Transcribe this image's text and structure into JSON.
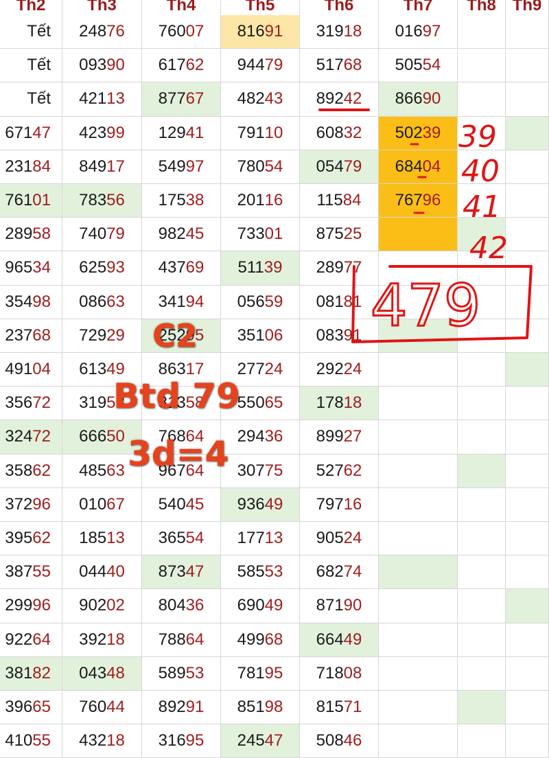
{
  "headers": [
    "Th2",
    "Th3",
    "Th4",
    "Th5",
    "Th6",
    "Th7",
    "Th8",
    "Th9"
  ],
  "rows": [
    [
      {
        "v": "Tết"
      },
      {
        "v": "24876"
      },
      {
        "v": "76007"
      },
      {
        "v": "81691",
        "bg": "yellow"
      },
      {
        "v": "31918"
      },
      {
        "v": "01697"
      },
      {
        "v": ""
      },
      {
        "v": ""
      }
    ],
    [
      {
        "v": "Tết"
      },
      {
        "v": "09390"
      },
      {
        "v": "61762"
      },
      {
        "v": "94479"
      },
      {
        "v": "51768"
      },
      {
        "v": "50554"
      },
      {
        "v": ""
      },
      {
        "v": ""
      }
    ],
    [
      {
        "v": "Tết"
      },
      {
        "v": "42113"
      },
      {
        "v": "87767",
        "bg": "green"
      },
      {
        "v": "48243"
      },
      {
        "v": "89242"
      },
      {
        "v": "86690",
        "bg": "green"
      },
      {
        "v": ""
      },
      {
        "v": ""
      }
    ],
    [
      {
        "v": "67147"
      },
      {
        "v": "42399"
      },
      {
        "v": "12941"
      },
      {
        "v": "79110"
      },
      {
        "v": "60832"
      },
      {
        "v": "50239",
        "bg": "orange"
      },
      {
        "v": ""
      },
      {
        "v": "",
        "bg": "green"
      }
    ],
    [
      {
        "v": "23184"
      },
      {
        "v": "84917"
      },
      {
        "v": "54997"
      },
      {
        "v": "78054"
      },
      {
        "v": "05479",
        "bg": "green"
      },
      {
        "v": "68404",
        "bg": "orange"
      },
      {
        "v": ""
      },
      {
        "v": ""
      }
    ],
    [
      {
        "v": "76101",
        "bg": "green"
      },
      {
        "v": "78356",
        "bg": "green"
      },
      {
        "v": "17538"
      },
      {
        "v": "20116"
      },
      {
        "v": "11584"
      },
      {
        "v": "76796",
        "bg": "orange"
      },
      {
        "v": ""
      },
      {
        "v": ""
      }
    ],
    [
      {
        "v": "28958"
      },
      {
        "v": "74079"
      },
      {
        "v": "98245"
      },
      {
        "v": "73301"
      },
      {
        "v": "87525"
      },
      {
        "v": "",
        "bg": "orange"
      },
      {
        "v": "",
        "bg": "green"
      },
      {
        "v": ""
      }
    ],
    [
      {
        "v": "96534"
      },
      {
        "v": "62593"
      },
      {
        "v": "43769"
      },
      {
        "v": "51139",
        "bg": "green"
      },
      {
        "v": "28977"
      },
      {
        "v": ""
      },
      {
        "v": ""
      },
      {
        "v": ""
      }
    ],
    [
      {
        "v": "35498"
      },
      {
        "v": "08663"
      },
      {
        "v": "34194"
      },
      {
        "v": "05659"
      },
      {
        "v": "08181"
      },
      {
        "v": ""
      },
      {
        "v": ""
      },
      {
        "v": ""
      }
    ],
    [
      {
        "v": "23768"
      },
      {
        "v": "72929"
      },
      {
        "v": "25295",
        "bg": "green"
      },
      {
        "v": "35106"
      },
      {
        "v": "08391"
      },
      {
        "v": "",
        "bg": "green"
      },
      {
        "v": ""
      },
      {
        "v": ""
      }
    ],
    [
      {
        "v": "49104"
      },
      {
        "v": "61349"
      },
      {
        "v": "86317"
      },
      {
        "v": "27724"
      },
      {
        "v": "29224"
      },
      {
        "v": ""
      },
      {
        "v": ""
      },
      {
        "v": "",
        "bg": "green"
      }
    ],
    [
      {
        "v": "35672"
      },
      {
        "v": "31953"
      },
      {
        "v": "81358"
      },
      {
        "v": "55065"
      },
      {
        "v": "17818",
        "bg": "green"
      },
      {
        "v": ""
      },
      {
        "v": ""
      },
      {
        "v": ""
      }
    ],
    [
      {
        "v": "32472",
        "bg": "green"
      },
      {
        "v": "66650",
        "bg": "green"
      },
      {
        "v": "76864"
      },
      {
        "v": "29436"
      },
      {
        "v": "89927"
      },
      {
        "v": ""
      },
      {
        "v": ""
      },
      {
        "v": ""
      }
    ],
    [
      {
        "v": "35862"
      },
      {
        "v": "48563"
      },
      {
        "v": "96764"
      },
      {
        "v": "30775"
      },
      {
        "v": "52762"
      },
      {
        "v": ""
      },
      {
        "v": "",
        "bg": "green"
      },
      {
        "v": ""
      }
    ],
    [
      {
        "v": "37296"
      },
      {
        "v": "01067"
      },
      {
        "v": "54045"
      },
      {
        "v": "93649",
        "bg": "green"
      },
      {
        "v": "79716"
      },
      {
        "v": ""
      },
      {
        "v": ""
      },
      {
        "v": ""
      }
    ],
    [
      {
        "v": "39562"
      },
      {
        "v": "18513"
      },
      {
        "v": "36554"
      },
      {
        "v": "17713"
      },
      {
        "v": "90524"
      },
      {
        "v": ""
      },
      {
        "v": ""
      },
      {
        "v": ""
      }
    ],
    [
      {
        "v": "38755"
      },
      {
        "v": "04440"
      },
      {
        "v": "87347",
        "bg": "green"
      },
      {
        "v": "58553"
      },
      {
        "v": "68274"
      },
      {
        "v": "",
        "bg": "green"
      },
      {
        "v": ""
      },
      {
        "v": ""
      }
    ],
    [
      {
        "v": "29996"
      },
      {
        "v": "90202"
      },
      {
        "v": "80436"
      },
      {
        "v": "69049"
      },
      {
        "v": "87190"
      },
      {
        "v": ""
      },
      {
        "v": ""
      },
      {
        "v": "",
        "bg": "green"
      }
    ],
    [
      {
        "v": "92264"
      },
      {
        "v": "39218"
      },
      {
        "v": "78864"
      },
      {
        "v": "49968"
      },
      {
        "v": "66449",
        "bg": "green"
      },
      {
        "v": ""
      },
      {
        "v": ""
      },
      {
        "v": ""
      }
    ],
    [
      {
        "v": "38182",
        "bg": "green"
      },
      {
        "v": "04348",
        "bg": "green"
      },
      {
        "v": "58953"
      },
      {
        "v": "78195"
      },
      {
        "v": "71808"
      },
      {
        "v": ""
      },
      {
        "v": ""
      },
      {
        "v": ""
      }
    ],
    [
      {
        "v": "39665"
      },
      {
        "v": "76044"
      },
      {
        "v": "89291"
      },
      {
        "v": "85198"
      },
      {
        "v": "81571"
      },
      {
        "v": ""
      },
      {
        "v": "",
        "bg": "green"
      },
      {
        "v": ""
      }
    ],
    [
      {
        "v": "41055"
      },
      {
        "v": "43218"
      },
      {
        "v": "31695"
      },
      {
        "v": "24547",
        "bg": "green"
      },
      {
        "v": "50846"
      },
      {
        "v": ""
      },
      {
        "v": ""
      },
      {
        "v": ""
      }
    ]
  ],
  "colors": {
    "header_text": "#9b1b1b",
    "tail_digits": "#a01e1e",
    "highlight_green": "#e2f1dc",
    "highlight_yellow": "#fde7a6",
    "highlight_orange": "#fbbe16",
    "annotation_red": "#e01414",
    "overlay_text": "#e8421b"
  },
  "annotations": {
    "counts": [
      "39",
      "40",
      "41",
      "42"
    ],
    "boxed_number": "479",
    "line1": "C2",
    "line2": "Btd 79",
    "line3": "3d=4"
  }
}
